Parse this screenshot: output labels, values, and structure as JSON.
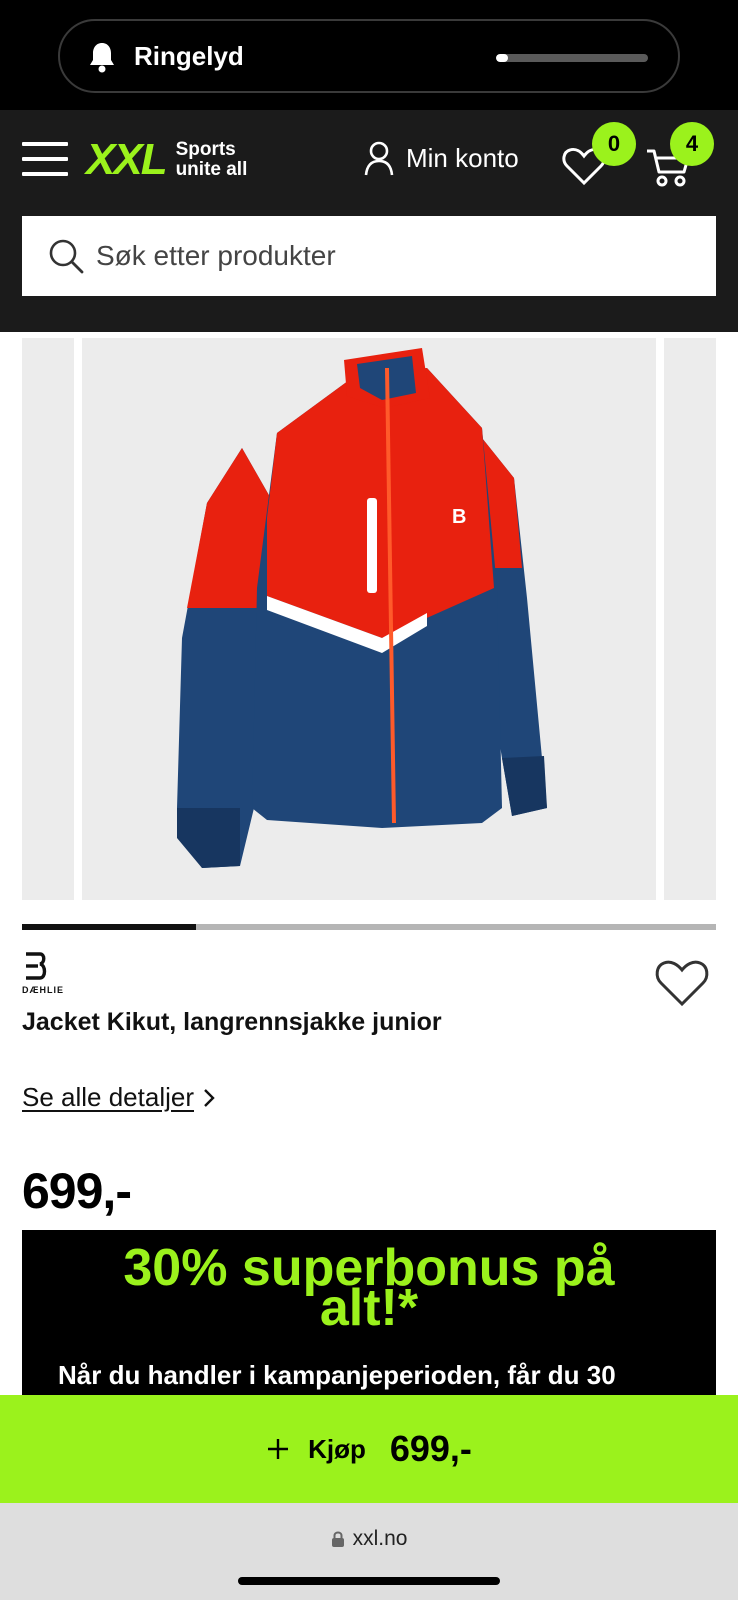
{
  "ringer": {
    "label": "Ringelyd",
    "level": 0.08
  },
  "header": {
    "logo_mark": "XXL",
    "logo_tagline_1": "Sports",
    "logo_tagline_2": "unite all",
    "account_label": "Min konto",
    "wishlist_count": "0",
    "cart_count": "4"
  },
  "search": {
    "placeholder": "Søk etter produkter"
  },
  "product": {
    "brand": "DÆHLIE",
    "title": "Jacket Kikut, langrennsjakke junior",
    "details_link": "Se alle detaljer",
    "price": "699,-",
    "gallery_position": 0.25
  },
  "promo": {
    "headline": "30% superbonus på alt!*",
    "body": "Når du handler i kampanjeperioden, får du 30"
  },
  "buy_bar": {
    "label": "Kjøp",
    "price": "699,-"
  },
  "browser": {
    "url": "xxl.no"
  },
  "colors": {
    "accent": "#9bf21c",
    "header_bg": "#1b1b1b",
    "jacket_red": "#e8210f",
    "jacket_navy": "#1f4678"
  }
}
